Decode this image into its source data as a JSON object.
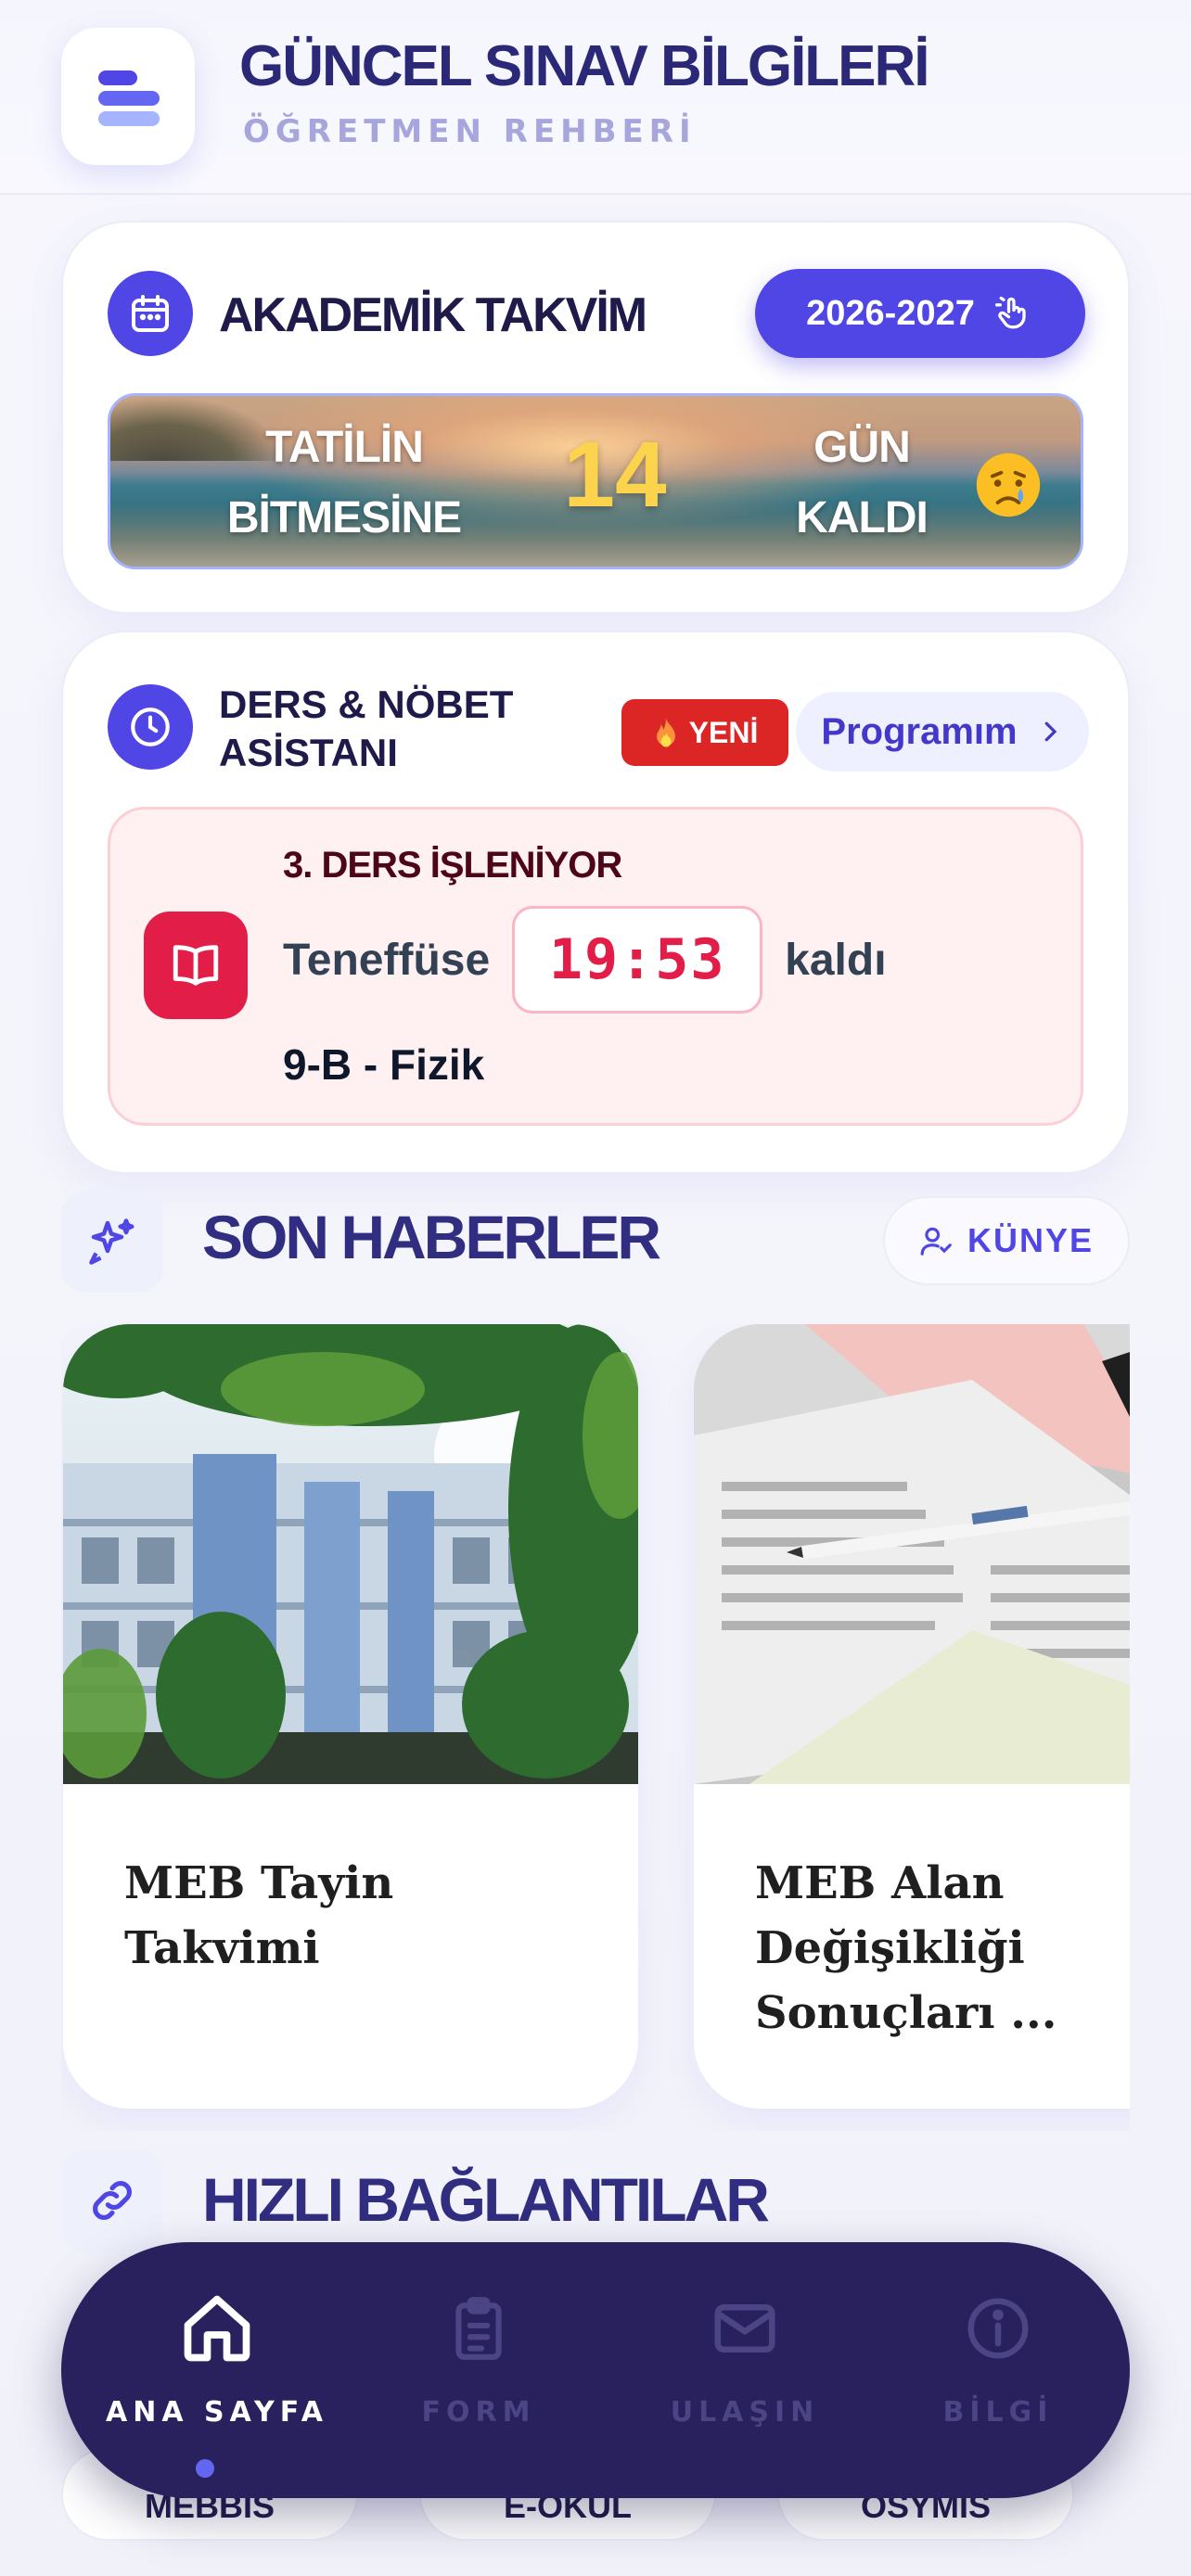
{
  "header": {
    "title": "GÜNCEL SINAV BİLGİLERİ",
    "subtitle": "ÖĞRETMEN REHBERİ",
    "logo_icon": "stacked-bars-logo-icon"
  },
  "calendar": {
    "title": "AKADEMİK TAKVİM",
    "icon": "calendar-icon",
    "year_button": "2026-2027",
    "year_button_icon": "tap-hand-icon",
    "banner": {
      "left_text": "TATİLİN BİTMESİNE",
      "number": "14",
      "right_text": "GÜN KALDI",
      "emoji": "crying-face-emoji"
    }
  },
  "assistant": {
    "title": "DERS & NÖBET ASİSTANI",
    "icon": "clock-icon",
    "badge": "YENİ",
    "badge_icon": "fire-icon",
    "program_button": "Programım",
    "lesson": {
      "status": "3. DERS İŞLENİYOR",
      "prefix": "Teneffüse",
      "timer": "19:53",
      "suffix": "kaldı",
      "class_subject": "9-B - Fizik",
      "icon": "open-book-icon"
    }
  },
  "news": {
    "title": "SON HABERLER",
    "icon": "sparkles-icon",
    "kunye_button": "KÜNYE",
    "kunye_icon": "user-check-icon",
    "items": [
      {
        "title": "MEB Tayin Takvimi",
        "image": "school-building-photo"
      },
      {
        "title": "MEB Alan Değişikliği Sonuçları ...",
        "image": "exam-answer-sheets-photo"
      }
    ]
  },
  "quick_links": {
    "title": "HIZLI BAĞLANTILAR",
    "icon": "link-icon",
    "items": [
      "MEBBİS",
      "E-OKUL",
      "ÖSYMİS"
    ]
  },
  "bottom_nav": {
    "items": [
      {
        "label": "ANA SAYFA",
        "icon": "home-icon",
        "active": true
      },
      {
        "label": "FORM",
        "icon": "clipboard-icon",
        "active": false
      },
      {
        "label": "ULAŞIN",
        "icon": "mail-icon",
        "active": false
      },
      {
        "label": "BİLGİ",
        "icon": "info-icon",
        "active": false
      }
    ]
  },
  "colors": {
    "primary": "#4f46e5",
    "title_navy": "#2c2878",
    "danger": "#e11d48",
    "nav_bg": "#29215e",
    "banner_number": "#fbd34d"
  }
}
